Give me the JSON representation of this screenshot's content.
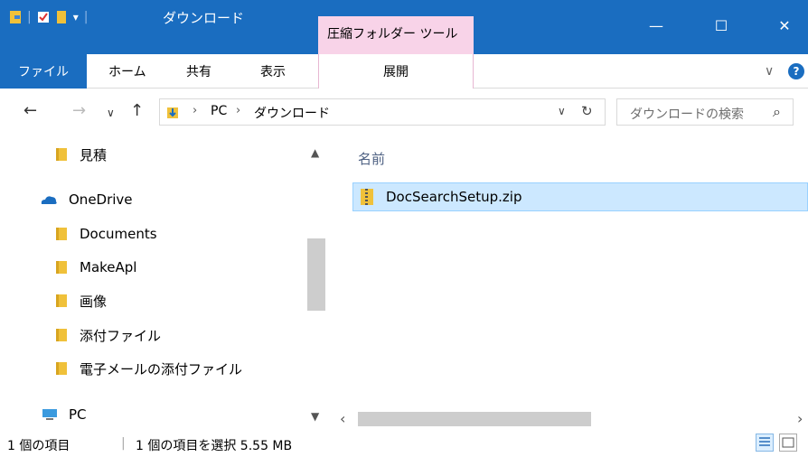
{
  "window": {
    "title": "ダウンロード",
    "context_tab": "圧縮フォルダー ツール",
    "minimize": "—",
    "maximize": "☐",
    "close": "✕"
  },
  "ribbon": {
    "tabs": [
      "ファイル",
      "ホーム",
      "共有",
      "表示",
      "展開"
    ],
    "collapse": "∨",
    "help": "?"
  },
  "address": {
    "back": "←",
    "forward": "→",
    "recent": "∨",
    "up": "↑",
    "sep": "›",
    "crumbs": [
      "PC",
      "ダウンロード"
    ],
    "dropdown": "∨",
    "refresh": "↻",
    "search_placeholder": "ダウンロードの検索",
    "search_icon": "⌕"
  },
  "nav": {
    "items": [
      {
        "label": "見積",
        "icon": "folder-icon"
      },
      {
        "label": "OneDrive",
        "icon": "onedrive-icon"
      },
      {
        "label": "Documents",
        "icon": "folder-icon"
      },
      {
        "label": "MakeApl",
        "icon": "folder-icon"
      },
      {
        "label": "画像",
        "icon": "folder-icon"
      },
      {
        "label": "添付ファイル",
        "icon": "folder-icon"
      },
      {
        "label": "電子メールの添付ファイル",
        "icon": "folder-icon"
      },
      {
        "label": "PC",
        "icon": "pc-icon"
      }
    ],
    "scroll_up": "▲",
    "scroll_down": "▼"
  },
  "content": {
    "column_header": "名前",
    "files": [
      {
        "name": "DocSearchSetup.zip",
        "icon": "zip-folder-icon",
        "selected": true
      }
    ],
    "scroll_left": "‹",
    "scroll_right": "›"
  },
  "status": {
    "item_count": "1 個の項目",
    "selection": "1 個の項目を選択  5.55 MB"
  },
  "colors": {
    "titlebar": "#1a6dc0",
    "context_tab": "#f8d3e8",
    "selection": "#cce8ff"
  }
}
